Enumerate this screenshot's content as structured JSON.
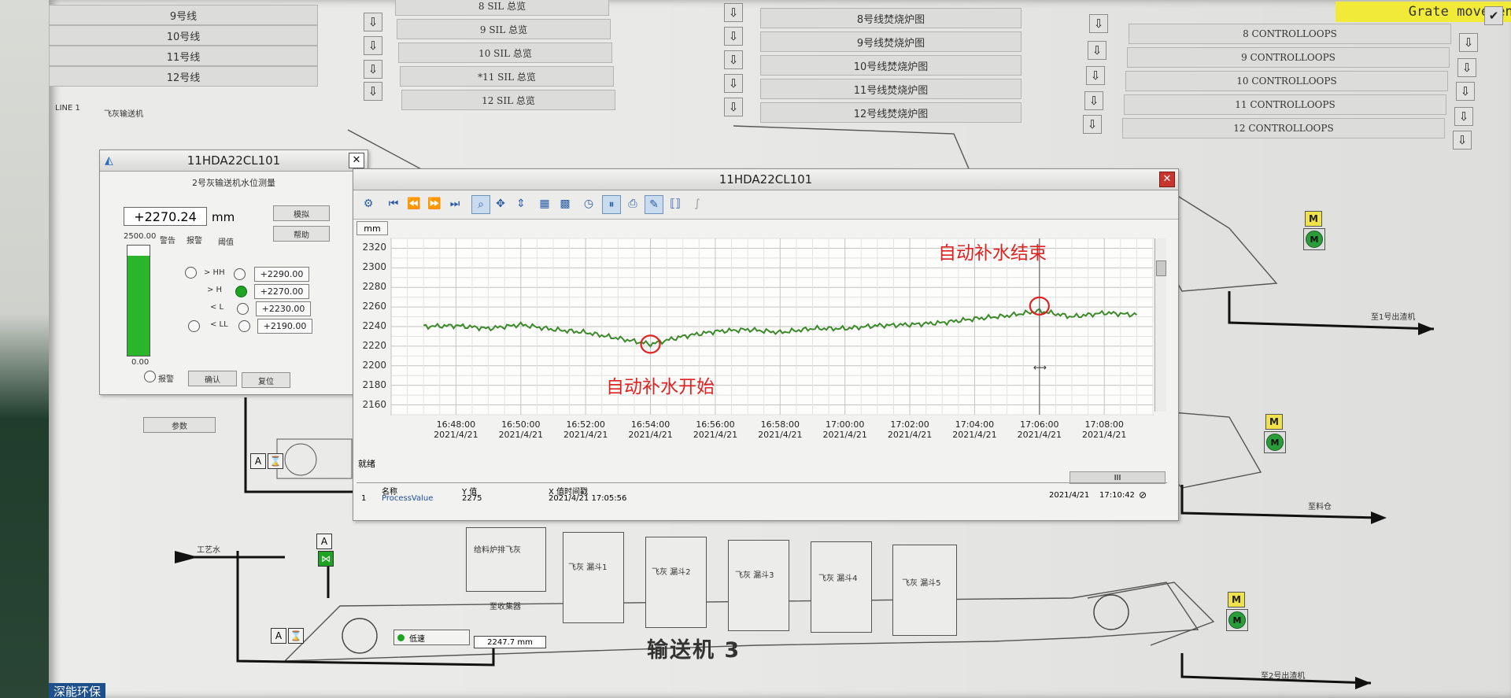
{
  "menu": {
    "lines": [
      "9号线",
      "10号线",
      "11号线",
      "12号线"
    ],
    "sil": [
      "8 SIL 总览",
      "9 SIL 总览",
      "10 SIL 总览",
      "*11 SIL 总览",
      "12 SIL 总览"
    ],
    "furnace": [
      "8号线焚烧炉图",
      "9号线焚烧炉图",
      "10号线焚烧炉图",
      "11号线焚烧炉图",
      "12号线焚烧炉图"
    ],
    "controlloops": [
      "8 CONTROLLOOPS",
      "9 CONTROLLOOPS",
      "10 CONTROLLOOPS",
      "11 CONTROLLOOPS",
      "12 CONTROLLOOPS"
    ],
    "grate": "Grate movement",
    "line_label": "LINE 1",
    "conveyor_label": "飞灰输送机"
  },
  "level_panel": {
    "title": "11HDA22CL101",
    "subtitle": "2号灰输送机水位测量",
    "value": "+2270.24",
    "unit": "mm",
    "btn_sim": "模拟",
    "btn_help": "帮助",
    "scale_max": "2500.00",
    "scale_min": "0.00",
    "col_alarm": "警告",
    "col_report": "报警",
    "col_limit": "阈值",
    "fill_fraction": 0.91,
    "limits": [
      {
        "label": "> HH",
        "value": "+2290.00",
        "on": false
      },
      {
        "label": "> H",
        "value": "+2270.00",
        "on": true
      },
      {
        "label": "< L",
        "value": "+2230.00",
        "on": false
      },
      {
        "label": "< LL",
        "value": "+2190.00",
        "on": false
      }
    ],
    "btn_alarm": "报警",
    "btn_confirm": "确认",
    "btn_reset": "复位",
    "btn_param": "参数"
  },
  "trend": {
    "title": "11HDA22CL101",
    "unit": "mm",
    "status": "就绪",
    "table_headers": [
      "名称",
      "Y 值",
      "X 值时间戳"
    ],
    "table_row": [
      "1",
      "ProcessValue",
      "2275",
      "2021/4/21 17:05:56"
    ],
    "footer_date": "2021/4/21",
    "footer_time": "17:10:42",
    "scrollbar_label": "III",
    "annotation_start": "自动补水开始",
    "annotation_end": "自动补水结束",
    "line_color": "#3c8a2a",
    "marker_color": "#e02222"
  },
  "chart_data": {
    "type": "line",
    "ylim": [
      2150,
      2330
    ],
    "yticks": [
      2320,
      2300,
      2280,
      2260,
      2240,
      2220,
      2200,
      2180,
      2160
    ],
    "xticks": [
      {
        "t": "16:48:00",
        "d": "2021/4/21"
      },
      {
        "t": "16:50:00",
        "d": "2021/4/21"
      },
      {
        "t": "16:52:00",
        "d": "2021/4/21"
      },
      {
        "t": "16:54:00",
        "d": "2021/4/21"
      },
      {
        "t": "16:56:00",
        "d": "2021/4/21"
      },
      {
        "t": "16:58:00",
        "d": "2021/4/21"
      },
      {
        "t": "17:00:00",
        "d": "2021/4/21"
      },
      {
        "t": "17:02:00",
        "d": "2021/4/21"
      },
      {
        "t": "17:04:00",
        "d": "2021/4/21"
      },
      {
        "t": "17:06:00",
        "d": "2021/4/21"
      },
      {
        "t": "17:08:00",
        "d": "2021/4/21"
      }
    ],
    "series": [
      {
        "x": [
          "16:47",
          "16:48",
          "16:49",
          "16:50",
          "16:51",
          "16:52",
          "16:53",
          "16:54",
          "16:55",
          "16:56",
          "16:57",
          "16:58",
          "16:59",
          "17:00",
          "17:01",
          "17:02",
          "17:03",
          "17:04",
          "17:05",
          "17:06",
          "17:07",
          "17:08",
          "17:09"
        ],
        "values": [
          2240,
          2241,
          2238,
          2242,
          2237,
          2234,
          2228,
          2222,
          2230,
          2235,
          2237,
          2234,
          2238,
          2238,
          2241,
          2242,
          2244,
          2248,
          2251,
          2256,
          2250,
          2254,
          2252
        ]
      }
    ],
    "annotations": [
      {
        "x": "16:54",
        "y": 2222
      },
      {
        "x": "17:06",
        "y": 2261
      }
    ]
  },
  "process": {
    "conveyor3": "输送机 3",
    "hopper_labels": [
      "飞灰 漏斗1",
      "飞灰 漏斗2",
      "飞灰 漏斗3",
      "飞灰 漏斗4",
      "飞灰 漏斗5"
    ],
    "mixer_label": "给料炉排飞灰",
    "ash_label": "至收集器",
    "status_label": "低速",
    "reading": "2247.7 mm",
    "to_label_1": "至1号出渣机",
    "to_label_2": "至料仓",
    "to_label_3": "至2号出渣机",
    "src_label": "工艺水",
    "mode_A": "A",
    "mode_M": "M"
  },
  "watermark": "深能环保"
}
